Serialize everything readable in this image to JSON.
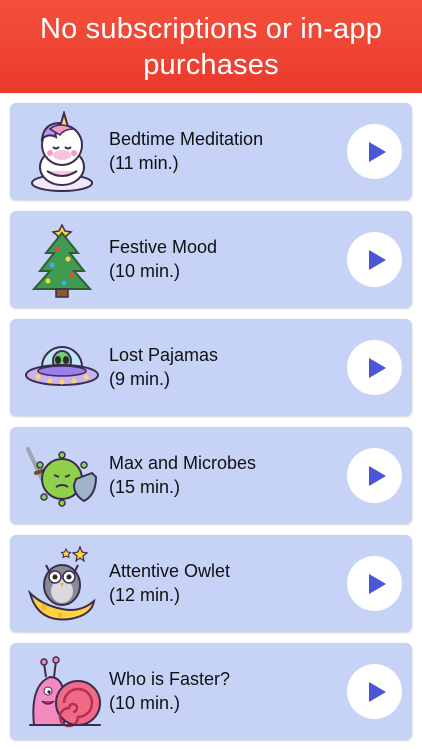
{
  "banner": {
    "title": "No subscriptions or in-app purchases",
    "color": "#ef4634"
  },
  "colors": {
    "card": "#c6d2f6",
    "play_icon": "#4a55d9",
    "play_button": "#ffffff"
  },
  "stories": [
    {
      "title": "Bedtime Meditation",
      "duration": "(11 min.)",
      "icon": "meditating-unicorn-icon"
    },
    {
      "title": "Festive Mood",
      "duration": "(10 min.)",
      "icon": "christmas-tree-icon"
    },
    {
      "title": "Lost Pajamas",
      "duration": "(9 min.)",
      "icon": "alien-ufo-icon"
    },
    {
      "title": "Max and Microbes",
      "duration": "(15 min.)",
      "icon": "germ-with-shield-icon"
    },
    {
      "title": "Attentive Owlet",
      "duration": "(12 min.)",
      "icon": "owl-on-moon-icon"
    },
    {
      "title": "Who is Faster?",
      "duration": "(10 min.)",
      "icon": "snail-icon"
    }
  ]
}
